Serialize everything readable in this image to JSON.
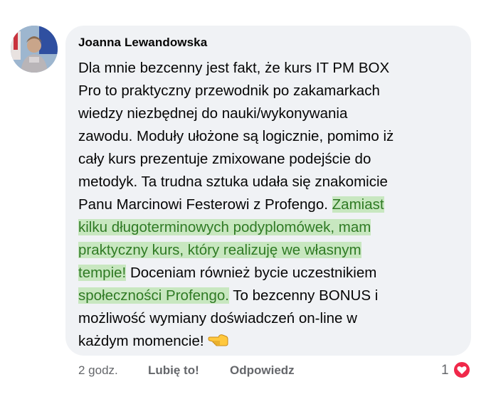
{
  "comment": {
    "author": "Joanna Lewandowska",
    "lines": [
      "Dla mnie bezcenny jest fakt, że kurs IT PM BOX",
      "Pro to praktyczny przewodnik po zakamarkach",
      "wiedzy niezbędnej do nauki/wykonywania",
      "zawodu. Moduły ułożone są logicznie, pomimo iż",
      "cały kurs prezentuje zmixowane podejście do",
      "metodyk. Ta trudna sztuka udała się znakomicie",
      "Panu Marcinowi Festerowi z Profengo.",
      "kilku długoterminowych podyplomówek, mam",
      "praktyczny kurs, który realizuję we własnym",
      "Doceniam również bycie uczestnikiem",
      "To bezcenny BONUS i",
      "możliwość wymiany doświadczeń on-line w",
      "każdym momencie!"
    ],
    "highlights": {
      "h1": "Zamiast",
      "h2": "tempie!",
      "h3": "społeczności Profengo."
    },
    "emoji": "backhand-index-pointing-left-icon"
  },
  "footer": {
    "time": "2 godz.",
    "like_label": "Lubię to!",
    "reply_label": "Odpowiedz",
    "reaction_count": "1",
    "reaction_icon": "heart-icon"
  },
  "colors": {
    "bubble": "#f0f2f5",
    "highlight_bg": "#c8e7c0",
    "highlight_text": "#2f7a24",
    "heart": "#f0284a",
    "meta_text": "#65676b"
  }
}
